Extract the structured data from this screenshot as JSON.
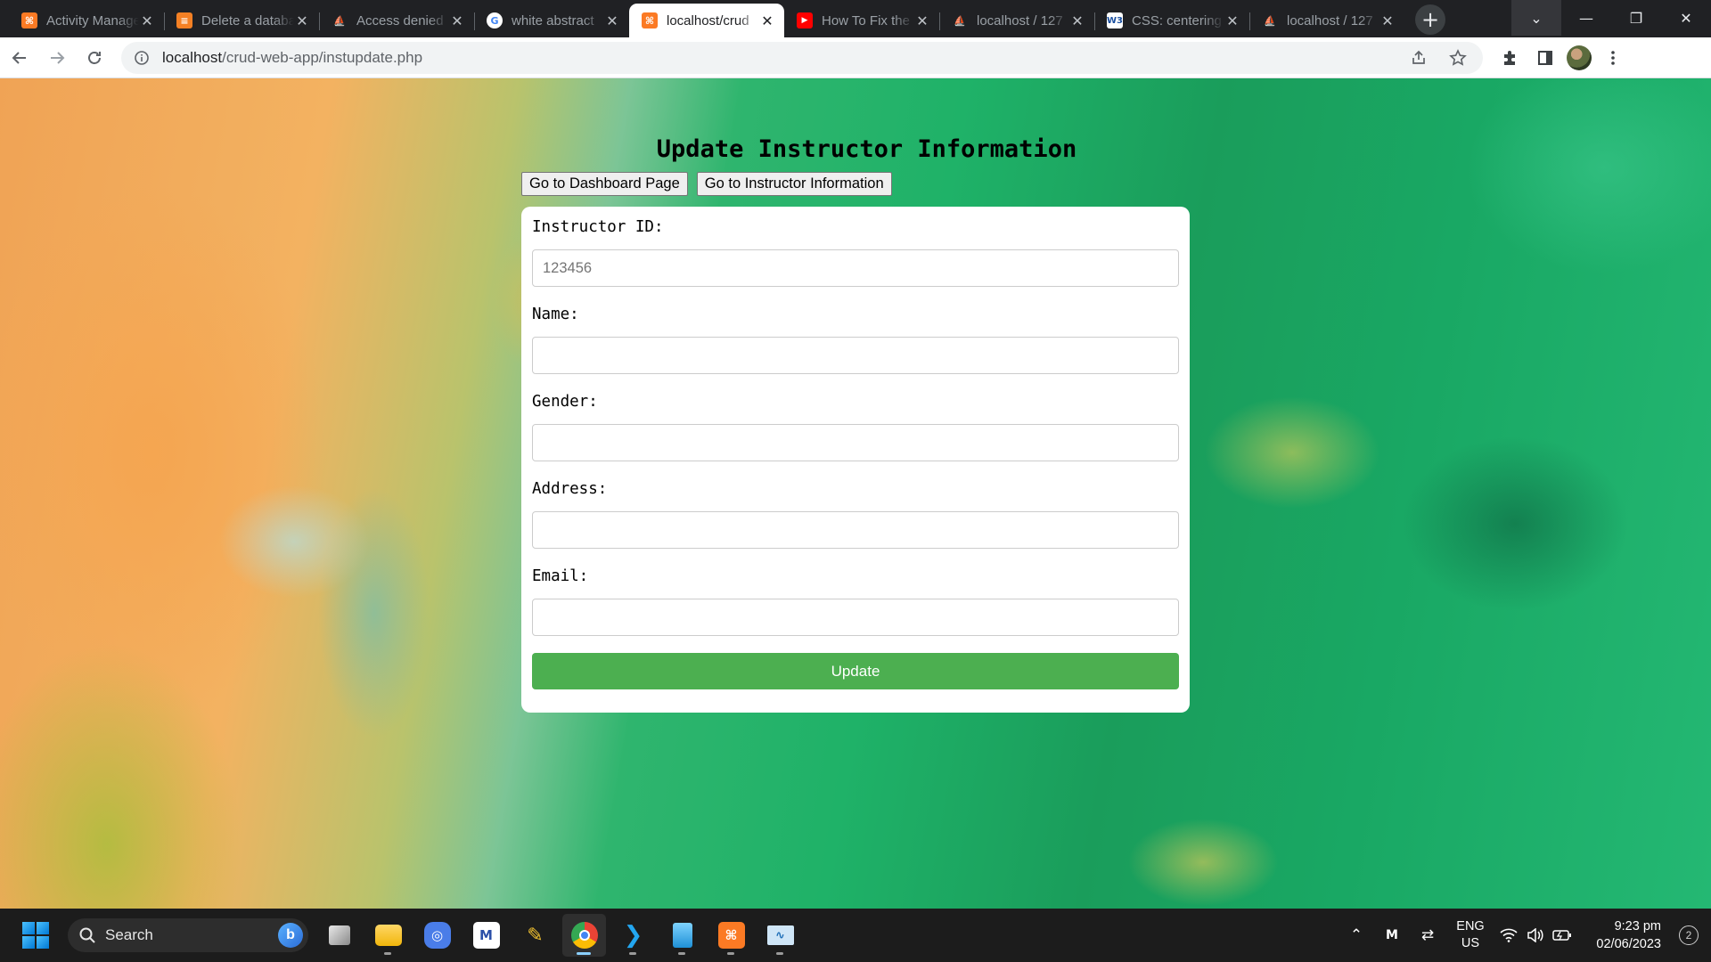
{
  "browser": {
    "tabs": [
      {
        "title": "Activity Manager",
        "favicon": "xampp-icon",
        "color": "#fb7a24",
        "glyph": "⌘"
      },
      {
        "title": "Delete a database",
        "favicon": "stackoverflow-icon",
        "color": "#f48024",
        "glyph": "≡"
      },
      {
        "title": "Access denied",
        "favicon": "phpmyadmin-icon",
        "color": "#f0a030",
        "glyph": "⛵"
      },
      {
        "title": "white abstract",
        "favicon": "google-icon",
        "color": "#ffffff",
        "glyph": "G"
      },
      {
        "title": "localhost/crud",
        "favicon": "xampp-icon",
        "color": "#fb7a24",
        "glyph": "⌘",
        "active": true
      },
      {
        "title": "How To Fix the",
        "favicon": "youtube-icon",
        "color": "#ff0000",
        "glyph": "▶"
      },
      {
        "title": "localhost / 127",
        "favicon": "phpmyadmin-icon",
        "color": "#f0a030",
        "glyph": "⛵"
      },
      {
        "title": "CSS: centering",
        "favicon": "w3schools-icon",
        "color": "#ffffff",
        "glyph": "W3"
      },
      {
        "title": "localhost / 127",
        "favicon": "phpmyadmin-icon",
        "color": "#f0a030",
        "glyph": "⛵"
      }
    ],
    "url_host": "localhost",
    "url_path": "/crud-web-app/instupdate.php"
  },
  "page": {
    "title": "Update Instructor Information",
    "nav_buttons": [
      "Go to Dashboard Page",
      "Go to Instructor Information"
    ],
    "form": {
      "fields": [
        {
          "label": "Instructor ID:",
          "value": "",
          "placeholder": "123456"
        },
        {
          "label": "Name:",
          "value": "",
          "placeholder": ""
        },
        {
          "label": "Gender:",
          "value": "",
          "placeholder": ""
        },
        {
          "label": "Address:",
          "value": "",
          "placeholder": ""
        },
        {
          "label": "Email:",
          "value": "",
          "placeholder": ""
        }
      ],
      "submit_label": "Update"
    }
  },
  "taskbar": {
    "search_label": "Search",
    "lang_line1": "ENG",
    "lang_line2": "US",
    "time": "9:23 pm",
    "date": "02/06/2023",
    "notification_count": "2"
  }
}
